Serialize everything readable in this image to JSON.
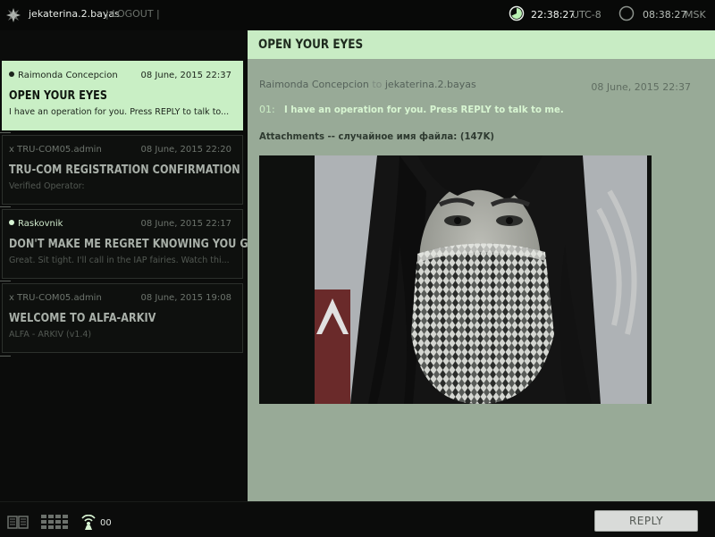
{
  "header": {
    "username": "jekaterina.2.bayas",
    "logout_label": "| LOGOUT |",
    "clock1": {
      "time": "22:38:27",
      "zone": "UTC-8"
    },
    "clock2": {
      "time": "08:38:27",
      "zone": "MSK"
    }
  },
  "messages": [
    {
      "sender": "Raimonda Concepcion",
      "date": "08 June, 2015 22:37",
      "subject": "OPEN YOUR EYES",
      "preview": "I have an operation for you. Press REPLY to talk to...",
      "selected": true
    },
    {
      "sender": "x TRU-COM05.admin",
      "date": "08 June, 2015 22:20",
      "subject": "TRU-COM REGISTRATION CONFIRMATION",
      "preview": "Verified Operator:"
    },
    {
      "sender": "Raskovnik",
      "date": "08 June, 2015 22:17",
      "subject": "DON'T MAKE ME REGRET KNOWING YOU GRING...",
      "preview": "Great. Sit tight. I'll call in the IAP fairies. Watch thi..."
    },
    {
      "sender": "x TRU-COM05.admin",
      "date": "08 June, 2015 19:08",
      "subject": "WELCOME TO ALFA-ARKIV",
      "preview": "ALFA - ARKIV  (v1.4)"
    }
  ],
  "detail": {
    "title": "OPEN YOUR EYES",
    "from": "Raimonda Concepcion",
    "to_word": "to",
    "to": "jekaterina.2.bayas",
    "date": "08 June, 2015 22:37",
    "line_number": "01:",
    "body": "I have an operation for you. Press REPLY to talk to me.",
    "attachments": "Attachments -- случайное имя файла: (147K)"
  },
  "footer": {
    "signal_count": "00",
    "reply_label": "REPLY"
  },
  "colors": {
    "accent_green": "#c9efc5",
    "detail_bg": "#98aa97",
    "app_bg": "#0b0c0b"
  },
  "icons": [
    "logo-icon",
    "clock-icon",
    "book-icon",
    "grid-icon",
    "signal-icon"
  ]
}
